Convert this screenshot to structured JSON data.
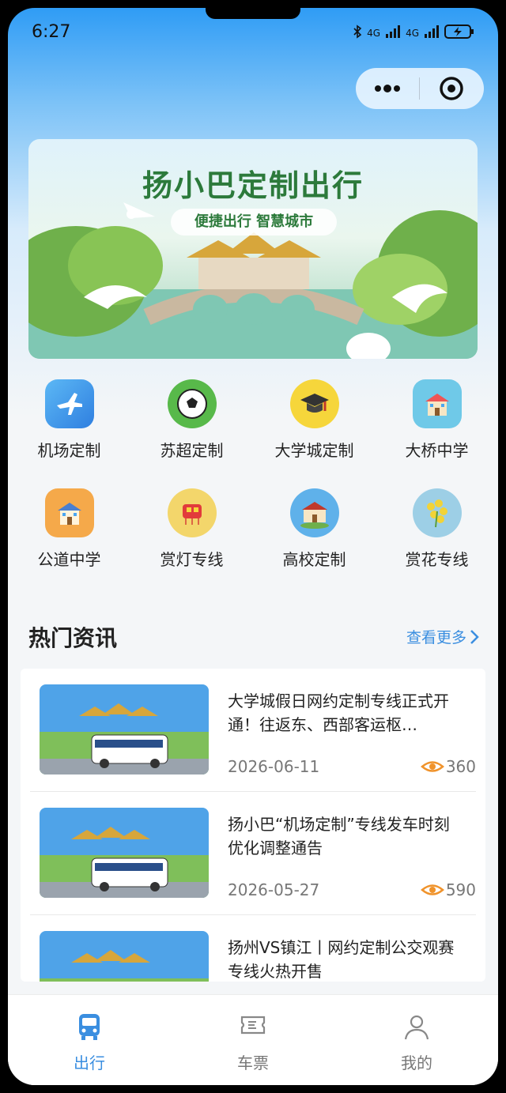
{
  "status_bar": {
    "time": "6:27",
    "network_1": "4G",
    "network_2": "4G"
  },
  "banner": {
    "title": "扬小巴定制出行",
    "subtitle": "便捷出行 智慧城市"
  },
  "services": [
    {
      "label": "机场定制",
      "icon": "airplane-icon",
      "color": "#4aa6f0"
    },
    {
      "label": "苏超定制",
      "icon": "soccer-ball-icon",
      "color": "#58b94a"
    },
    {
      "label": "大学城定制",
      "icon": "graduation-cap-icon",
      "color": "#f6d63b"
    },
    {
      "label": "大桥中学",
      "icon": "school-building-icon",
      "color": "#6fc9e8"
    },
    {
      "label": "公道中学",
      "icon": "school-building-icon",
      "color": "#f5a94a"
    },
    {
      "label": "赏灯专线",
      "icon": "lantern-icon",
      "color": "#f3d66b"
    },
    {
      "label": "高校定制",
      "icon": "campus-icon",
      "color": "#5fb1ea"
    },
    {
      "label": "赏花专线",
      "icon": "flower-icon",
      "color": "#9dcfe6"
    }
  ],
  "news": {
    "heading": "热门资讯",
    "more_label": "查看更多",
    "items": [
      {
        "title": "大学城假日网约定制专线正式开通！往返东、西部客运枢…",
        "date": "2026-06-11",
        "views": "360"
      },
      {
        "title": "扬小巴“机场定制”专线发车时刻优化调整通告",
        "date": "2026-05-27",
        "views": "590"
      },
      {
        "title": "扬州VS镇江丨网约定制公交观赛专线火热开售",
        "date": "",
        "views": ""
      }
    ]
  },
  "tabs": [
    {
      "label": "出行",
      "icon": "bus-icon",
      "active": true
    },
    {
      "label": "车票",
      "icon": "ticket-icon",
      "active": false
    },
    {
      "label": "我的",
      "icon": "user-icon",
      "active": false
    }
  ],
  "colors": {
    "accent": "#3a8ee0",
    "banner_green": "#2c7a3b",
    "view_icon": "#f0932b"
  }
}
